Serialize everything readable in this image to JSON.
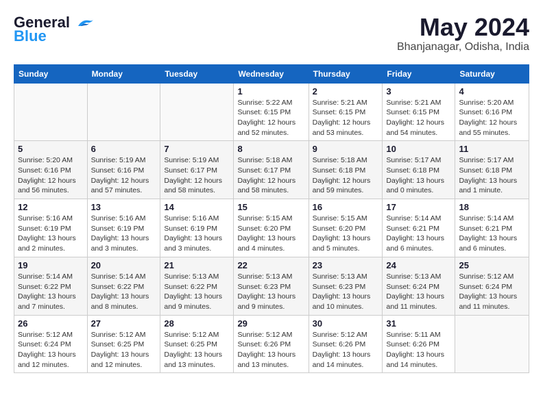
{
  "logo": {
    "line1": "General",
    "line2": "Blue"
  },
  "title": "May 2024",
  "location": "Bhanjanagar, Odisha, India",
  "days_of_week": [
    "Sunday",
    "Monday",
    "Tuesday",
    "Wednesday",
    "Thursday",
    "Friday",
    "Saturday"
  ],
  "weeks": [
    [
      {
        "num": "",
        "info": ""
      },
      {
        "num": "",
        "info": ""
      },
      {
        "num": "",
        "info": ""
      },
      {
        "num": "1",
        "info": "Sunrise: 5:22 AM\nSunset: 6:15 PM\nDaylight: 12 hours\nand 52 minutes."
      },
      {
        "num": "2",
        "info": "Sunrise: 5:21 AM\nSunset: 6:15 PM\nDaylight: 12 hours\nand 53 minutes."
      },
      {
        "num": "3",
        "info": "Sunrise: 5:21 AM\nSunset: 6:15 PM\nDaylight: 12 hours\nand 54 minutes."
      },
      {
        "num": "4",
        "info": "Sunrise: 5:20 AM\nSunset: 6:16 PM\nDaylight: 12 hours\nand 55 minutes."
      }
    ],
    [
      {
        "num": "5",
        "info": "Sunrise: 5:20 AM\nSunset: 6:16 PM\nDaylight: 12 hours\nand 56 minutes."
      },
      {
        "num": "6",
        "info": "Sunrise: 5:19 AM\nSunset: 6:16 PM\nDaylight: 12 hours\nand 57 minutes."
      },
      {
        "num": "7",
        "info": "Sunrise: 5:19 AM\nSunset: 6:17 PM\nDaylight: 12 hours\nand 58 minutes."
      },
      {
        "num": "8",
        "info": "Sunrise: 5:18 AM\nSunset: 6:17 PM\nDaylight: 12 hours\nand 58 minutes."
      },
      {
        "num": "9",
        "info": "Sunrise: 5:18 AM\nSunset: 6:18 PM\nDaylight: 12 hours\nand 59 minutes."
      },
      {
        "num": "10",
        "info": "Sunrise: 5:17 AM\nSunset: 6:18 PM\nDaylight: 13 hours\nand 0 minutes."
      },
      {
        "num": "11",
        "info": "Sunrise: 5:17 AM\nSunset: 6:18 PM\nDaylight: 13 hours\nand 1 minute."
      }
    ],
    [
      {
        "num": "12",
        "info": "Sunrise: 5:16 AM\nSunset: 6:19 PM\nDaylight: 13 hours\nand 2 minutes."
      },
      {
        "num": "13",
        "info": "Sunrise: 5:16 AM\nSunset: 6:19 PM\nDaylight: 13 hours\nand 3 minutes."
      },
      {
        "num": "14",
        "info": "Sunrise: 5:16 AM\nSunset: 6:19 PM\nDaylight: 13 hours\nand 3 minutes."
      },
      {
        "num": "15",
        "info": "Sunrise: 5:15 AM\nSunset: 6:20 PM\nDaylight: 13 hours\nand 4 minutes."
      },
      {
        "num": "16",
        "info": "Sunrise: 5:15 AM\nSunset: 6:20 PM\nDaylight: 13 hours\nand 5 minutes."
      },
      {
        "num": "17",
        "info": "Sunrise: 5:14 AM\nSunset: 6:21 PM\nDaylight: 13 hours\nand 6 minutes."
      },
      {
        "num": "18",
        "info": "Sunrise: 5:14 AM\nSunset: 6:21 PM\nDaylight: 13 hours\nand 6 minutes."
      }
    ],
    [
      {
        "num": "19",
        "info": "Sunrise: 5:14 AM\nSunset: 6:22 PM\nDaylight: 13 hours\nand 7 minutes."
      },
      {
        "num": "20",
        "info": "Sunrise: 5:14 AM\nSunset: 6:22 PM\nDaylight: 13 hours\nand 8 minutes."
      },
      {
        "num": "21",
        "info": "Sunrise: 5:13 AM\nSunset: 6:22 PM\nDaylight: 13 hours\nand 9 minutes."
      },
      {
        "num": "22",
        "info": "Sunrise: 5:13 AM\nSunset: 6:23 PM\nDaylight: 13 hours\nand 9 minutes."
      },
      {
        "num": "23",
        "info": "Sunrise: 5:13 AM\nSunset: 6:23 PM\nDaylight: 13 hours\nand 10 minutes."
      },
      {
        "num": "24",
        "info": "Sunrise: 5:13 AM\nSunset: 6:24 PM\nDaylight: 13 hours\nand 11 minutes."
      },
      {
        "num": "25",
        "info": "Sunrise: 5:12 AM\nSunset: 6:24 PM\nDaylight: 13 hours\nand 11 minutes."
      }
    ],
    [
      {
        "num": "26",
        "info": "Sunrise: 5:12 AM\nSunset: 6:24 PM\nDaylight: 13 hours\nand 12 minutes."
      },
      {
        "num": "27",
        "info": "Sunrise: 5:12 AM\nSunset: 6:25 PM\nDaylight: 13 hours\nand 12 minutes."
      },
      {
        "num": "28",
        "info": "Sunrise: 5:12 AM\nSunset: 6:25 PM\nDaylight: 13 hours\nand 13 minutes."
      },
      {
        "num": "29",
        "info": "Sunrise: 5:12 AM\nSunset: 6:26 PM\nDaylight: 13 hours\nand 13 minutes."
      },
      {
        "num": "30",
        "info": "Sunrise: 5:12 AM\nSunset: 6:26 PM\nDaylight: 13 hours\nand 14 minutes."
      },
      {
        "num": "31",
        "info": "Sunrise: 5:11 AM\nSunset: 6:26 PM\nDaylight: 13 hours\nand 14 minutes."
      },
      {
        "num": "",
        "info": ""
      }
    ]
  ]
}
